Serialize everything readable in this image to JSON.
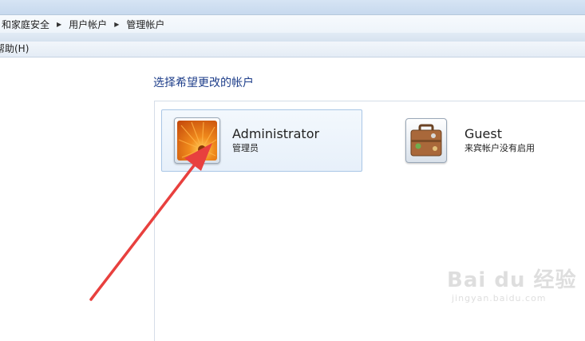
{
  "address_bar": {
    "crumbs": [
      "和家庭安全",
      "用户帐户",
      "管理帐户"
    ]
  },
  "menu": {
    "help_label": "帮助(H)"
  },
  "main": {
    "heading": "选择希望更改的帐户",
    "accounts": [
      {
        "name": "Administrator",
        "role": "管理员",
        "icon": "flower-avatar-icon",
        "selected": true
      },
      {
        "name": "Guest",
        "role": "来宾帐户没有启用",
        "icon": "briefcase-avatar-icon",
        "selected": false
      }
    ]
  },
  "watermark": {
    "brand": "Bai du 经验",
    "url": "jingyan.baidu.com"
  },
  "colors": {
    "heading": "#1e3e8a",
    "selection_fill": "#e7f0fa",
    "selection_border": "#a9c6e6",
    "arrow": "#e8403e"
  }
}
